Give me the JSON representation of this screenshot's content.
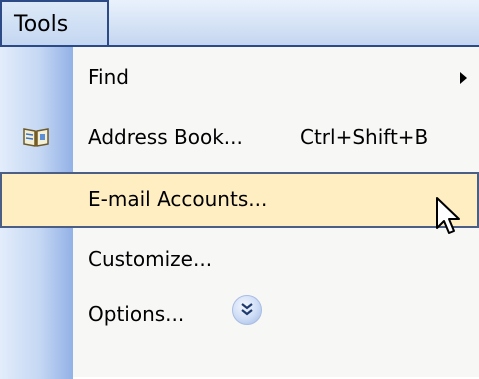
{
  "menubar": {
    "tab_label": "Tools"
  },
  "menu": {
    "items": [
      {
        "label": "Find",
        "shortcut": "",
        "has_submenu": true
      },
      {
        "label": "Address Book...",
        "shortcut": "Ctrl+Shift+B",
        "icon": "address-book-icon"
      },
      {
        "label": "E-mail Accounts...",
        "shortcut": "",
        "highlighted": true
      },
      {
        "label": "Customize...",
        "shortcut": ""
      },
      {
        "label": "Options...",
        "shortcut": ""
      }
    ],
    "expand_icon": "double-chevron-down-icon"
  },
  "colors": {
    "menu_border": "#2b4a86",
    "highlight_fill": "#ffeec2",
    "gutter_light": "#e3edfb",
    "gutter_dark": "#93b1e6"
  }
}
